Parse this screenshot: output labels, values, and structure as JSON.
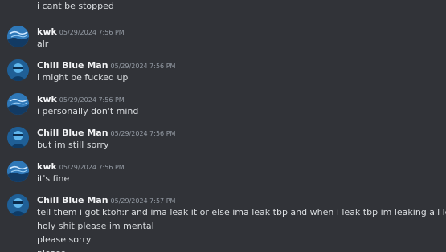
{
  "chat": {
    "leading_line": "i cant be stopped",
    "messages": [
      {
        "author": "kwk",
        "timestamp": "05/29/2024 7:56 PM",
        "avatar_icon": "kwk-avatar-icon",
        "lines": [
          "alr"
        ]
      },
      {
        "author": "Chill Blue Man",
        "timestamp": "05/29/2024 7:56 PM",
        "avatar_icon": "chill-blue-man-avatar-icon",
        "lines": [
          "i might be fucked up"
        ]
      },
      {
        "author": "kwk",
        "timestamp": "05/29/2024 7:56 PM",
        "avatar_icon": "kwk-avatar-icon",
        "lines": [
          "i personally don't mind"
        ]
      },
      {
        "author": "Chill Blue Man",
        "timestamp": "05/29/2024 7:56 PM",
        "avatar_icon": "chill-blue-man-avatar-icon",
        "lines": [
          "but im still sorry"
        ]
      },
      {
        "author": "kwk",
        "timestamp": "05/29/2024 7:56 PM",
        "avatar_icon": "kwk-avatar-icon",
        "lines": [
          "it's fine"
        ]
      },
      {
        "author": "Chill Blue Man",
        "timestamp": "05/29/2024 7:57 PM",
        "avatar_icon": "chill-blue-man-avatar-icon",
        "lines": [
          "tell them i got ktoh:r and ima leak it or else ima leak tbp and when i leak tbp im leaking all leaks inside of ktoh:r",
          "holy shit please im mental",
          "please sorry",
          "please"
        ]
      }
    ]
  },
  "colors": {
    "background": "#313338",
    "username": "#f2f3f5",
    "timestamp": "#949ba4",
    "message_text": "#dbdee1"
  }
}
